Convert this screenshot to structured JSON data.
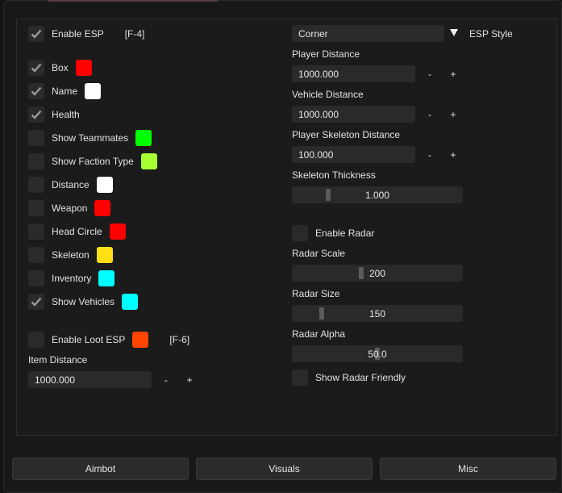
{
  "left": {
    "enable_esp": {
      "label": "Enable ESP",
      "hotkey": "[F-4]",
      "checked": true
    },
    "toggles": [
      {
        "label": "Box",
        "checked": true,
        "color": "#ff0000"
      },
      {
        "label": "Name",
        "checked": true,
        "color": "#ffffff"
      },
      {
        "label": "Health",
        "checked": true,
        "color": null
      },
      {
        "label": "Show Teammates",
        "checked": false,
        "color": "#00ff00"
      },
      {
        "label": "Show Faction Type",
        "checked": false,
        "color": "#a6ff33"
      },
      {
        "label": "Distance",
        "checked": false,
        "color": "#ffffff"
      },
      {
        "label": "Weapon",
        "checked": false,
        "color": "#ff0000"
      },
      {
        "label": "Head Circle",
        "checked": false,
        "color": "#ff0000"
      },
      {
        "label": "Skeleton",
        "checked": false,
        "color": "#ffe014"
      },
      {
        "label": "Inventory",
        "checked": false,
        "color": "#00ffff"
      },
      {
        "label": "Show Vehicles",
        "checked": true,
        "color": "#00ffff"
      }
    ],
    "enable_loot": {
      "label": "Enable Loot ESP",
      "hotkey": "[F-6]",
      "checked": false,
      "color": "#ff4500"
    },
    "item_distance": {
      "label": "Item Distance",
      "value": "1000.000",
      "minus": "-",
      "plus": "+"
    }
  },
  "right": {
    "esp_style": {
      "value": "Corner",
      "label": "ESP Style"
    },
    "player_distance": {
      "label": "Player Distance",
      "value": "1000.000",
      "minus": "-",
      "plus": "+"
    },
    "vehicle_distance": {
      "label": "Vehicle Distance",
      "value": "1000.000",
      "minus": "-",
      "plus": "+"
    },
    "skeleton_distance": {
      "label": "Player Skeleton Distance",
      "value": "100.000",
      "minus": "-",
      "plus": "+"
    },
    "skeleton_thickness": {
      "label": "Skeleton Thickness",
      "value": "1.000",
      "fraction": 0.2
    },
    "enable_radar": {
      "label": "Enable Radar",
      "checked": false
    },
    "radar_scale": {
      "label": "Radar Scale",
      "value": "200",
      "fraction": 0.4
    },
    "radar_size": {
      "label": "Radar Size",
      "value": "150",
      "fraction": 0.16
    },
    "radar_alpha": {
      "label": "Radar Alpha",
      "value": "50.0",
      "fraction": 0.5
    },
    "show_radar_friendly": {
      "label": "Show Radar Friendly",
      "checked": false
    }
  },
  "tabs": [
    {
      "label": "Aimbot"
    },
    {
      "label": "Visuals"
    },
    {
      "label": "Misc"
    }
  ]
}
